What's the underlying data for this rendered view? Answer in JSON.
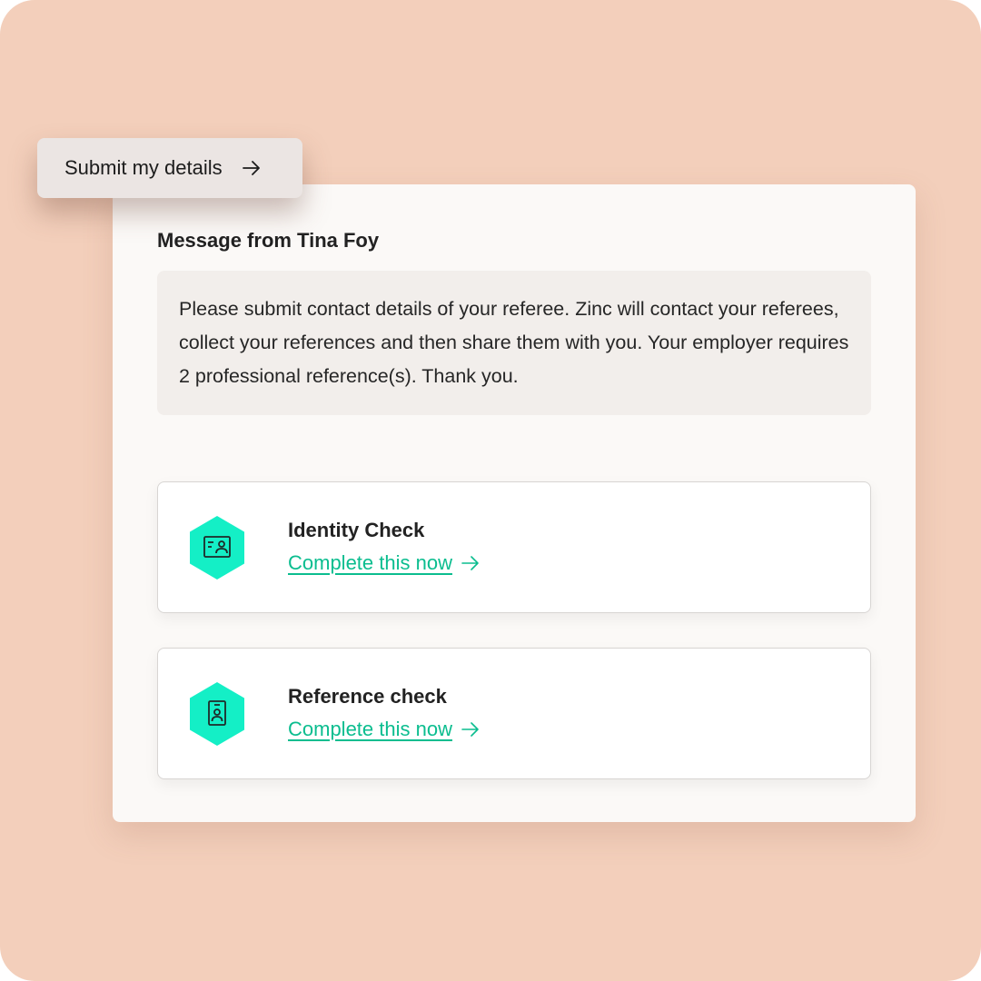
{
  "submit_button": {
    "label": "Submit my details",
    "icon": "arrow-right-icon"
  },
  "message": {
    "heading": "Message from Tina Foy",
    "body": "Please submit contact details of your referee. Zinc will contact your referees, collect your references and then share them with you. Your employer requires 2 professional reference(s). Thank you."
  },
  "checks": [
    {
      "title": "Identity Check",
      "link_label": "Complete this now",
      "icon": "id-card-icon"
    },
    {
      "title": "Reference check",
      "link_label": "Complete this now",
      "icon": "badge-icon"
    }
  ],
  "colors": {
    "background": "#f3cfbb",
    "panel": "#fbf9f7",
    "accent": "#0bbd8f",
    "hex_icon": "#14efc6"
  }
}
